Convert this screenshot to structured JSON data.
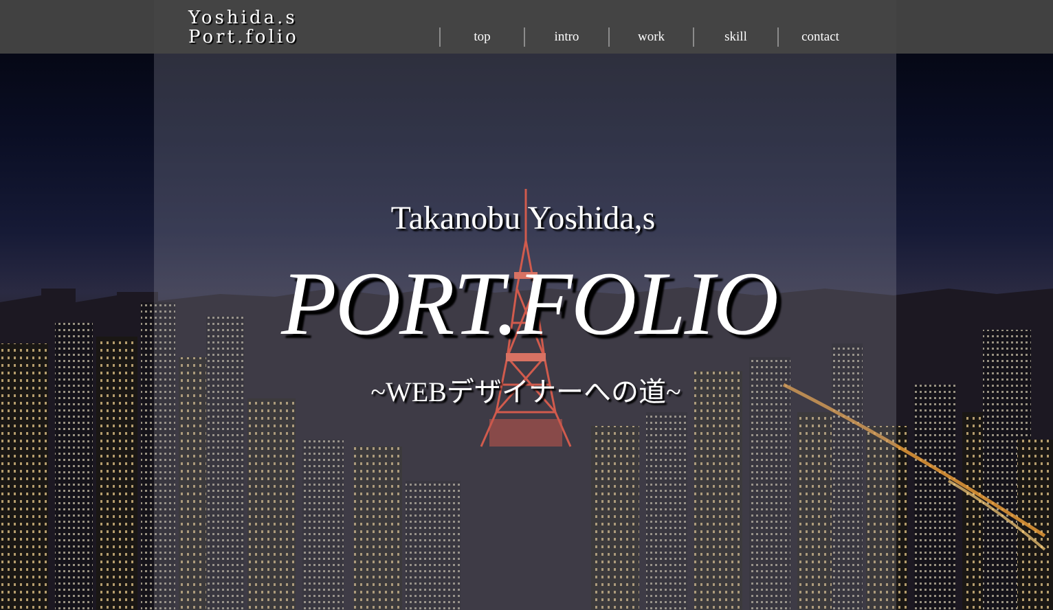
{
  "header": {
    "logo_line1": "Yoshida.s",
    "logo_line2": "Port.folio",
    "nav": [
      {
        "label": "top"
      },
      {
        "label": "intro"
      },
      {
        "label": "work"
      },
      {
        "label": "skill"
      },
      {
        "label": "contact"
      }
    ]
  },
  "hero": {
    "name": "Takanobu Yoshida,s",
    "title": "PORT.FOLIO",
    "subtitle": "~WEBデザイナーへの道~"
  },
  "colors": {
    "header_bg": "#444444",
    "text": "#ffffff",
    "tower": "#e0402a"
  }
}
